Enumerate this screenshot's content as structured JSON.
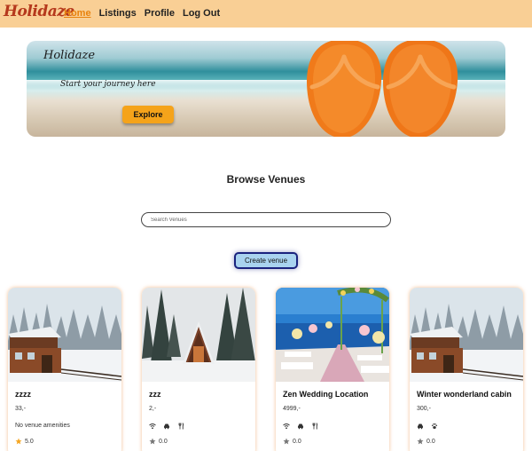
{
  "header": {
    "logo": "Holidaze",
    "nav": [
      {
        "label": "Home",
        "active": true
      },
      {
        "label": "Listings",
        "active": false
      },
      {
        "label": "Profile",
        "active": false
      },
      {
        "label": "Log Out",
        "active": false
      }
    ]
  },
  "hero": {
    "title": "Holidaze",
    "tagline": "Start your journey here",
    "button_label": "Explore"
  },
  "browse": {
    "title": "Browse Venues",
    "search_placeholder": "Search Venues",
    "create_label": "Create venue"
  },
  "venues": [
    {
      "name": "zzzz",
      "price": "33,-",
      "amenities_text": "No venue amenities",
      "amenities": [],
      "rating": "5.0",
      "star_color": "#f5a623",
      "image": "snowy-wooden-house"
    },
    {
      "name": "zzz",
      "price": "2,-",
      "amenities_text": "",
      "amenities": [
        "wifi-icon",
        "car-icon",
        "cutlery-icon"
      ],
      "rating": "0.0",
      "star_color": "#777777",
      "image": "a-frame-cabin-snow"
    },
    {
      "name": "Zen Wedding Location",
      "price": "4999,-",
      "amenities_text": "",
      "amenities": [
        "wifi-icon",
        "car-icon",
        "cutlery-icon"
      ],
      "rating": "0.0",
      "star_color": "#777777",
      "image": "beach-wedding-aisle"
    },
    {
      "name": "Winter wonderland cabin",
      "price": "300,-",
      "amenities_text": "",
      "amenities": [
        "car-icon",
        "paw-icon"
      ],
      "rating": "0.0",
      "star_color": "#777777",
      "image": "snowy-wooden-house"
    }
  ],
  "colors": {
    "header_bg": "#f9cf95",
    "logo": "#b5381c",
    "active_nav": "#e8820c",
    "explore_button": "#f5a31a",
    "create_button": "#a9d3ef",
    "create_border": "#1a237e"
  }
}
